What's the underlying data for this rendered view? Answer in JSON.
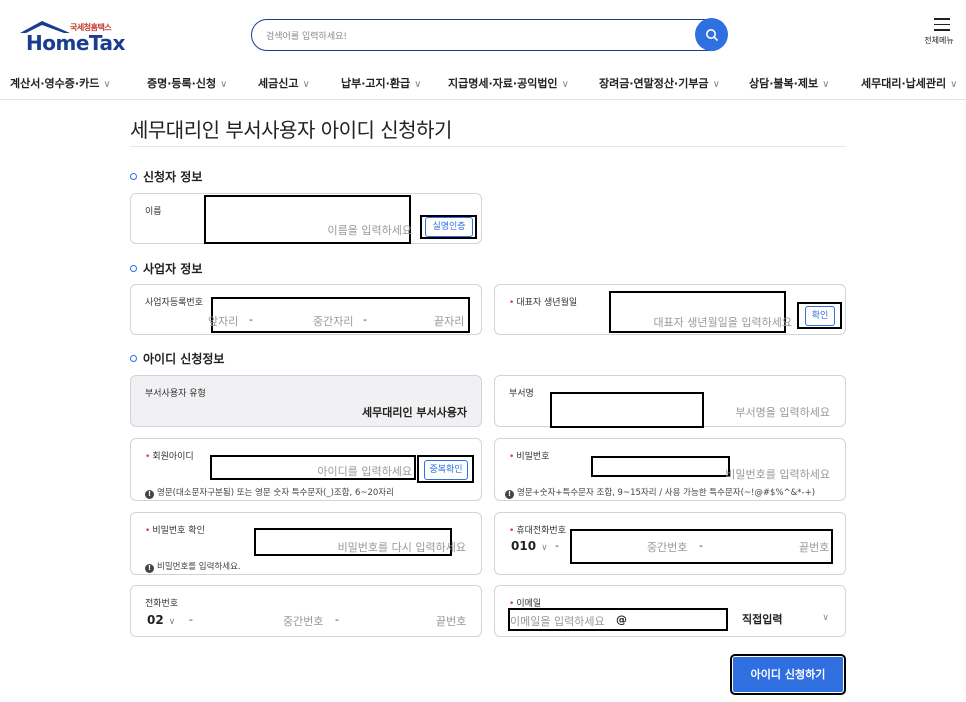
{
  "logo": {
    "sub": "국세청홈택스",
    "main": "HomeTax"
  },
  "search": {
    "placeholder": "검색어를 입력하세요!"
  },
  "menu": {
    "label": "전체메뉴"
  },
  "nav": [
    "계산서·영수증·카드",
    "증명·등록·신청",
    "세금신고",
    "납부·고지·환급",
    "지급명세·자료·공익법인",
    "장려금·연말정산·기부금",
    "상담·불복·제보",
    "세무대리·납세관리"
  ],
  "page_title": "세무대리인 부서사용자 아이디 신청하기",
  "sections": {
    "applicant": "신청자 정보",
    "business": "사업자 정보",
    "id_info": "아이디 신청정보"
  },
  "applicant": {
    "name_label": "이름",
    "name_placeholder": "이름을 입력하세요",
    "verify_button": "실명인증"
  },
  "business": {
    "bizno_label": "사업자등록번호",
    "bizno_front": "앞자리",
    "bizno_dash1": "-",
    "bizno_mid": "중간자리",
    "bizno_dash2": "-",
    "bizno_end": "끝자리",
    "rep_birth_label": "대표자 생년월일",
    "rep_birth_placeholder": "대표자 생년월일을 입력하세요",
    "confirm_button": "확인"
  },
  "id_info": {
    "user_type_label": "부서사용자 유형",
    "user_type_value": "세무대리인 부서사용자",
    "dept_label": "부서명",
    "dept_placeholder": "부서명을 입력하세요",
    "member_id_label": "회원아이디",
    "member_id_placeholder": "아이디를 입력하세요",
    "dup_check_button": "중복확인",
    "member_id_hint": "영문(대소문자구분됨) 또는 영문 숫자 특수문자(_)조합, 6~20자리",
    "password_label": "비밀번호",
    "password_placeholder": "비밀번호를 입력하세요",
    "password_hint": "영문+숫자+특수문자 조합, 9~15자리 / 사용 가능한 특수문자(~!@#$%^&*-+)",
    "password_confirm_label": "비밀번호 확인",
    "password_confirm_placeholder": "비밀번호를 다시 입력하세요",
    "password_confirm_hint": "비밀번호를 입력하세요.",
    "mobile_label": "휴대전화번호",
    "mobile_prefix": "010",
    "mobile_dash": "-",
    "mobile_mid": "중간번호",
    "mobile_dash2": "-",
    "mobile_end": "끝번호",
    "phone_label": "전화번호",
    "phone_prefix": "02",
    "phone_dash": "-",
    "phone_mid": "중간번호",
    "phone_dash2": "-",
    "phone_end": "끝번호",
    "email_label": "이메일",
    "email_placeholder": "이메일을 입력하세요",
    "email_at": "@",
    "email_domain": "직접입력"
  },
  "submit_label": "아이디 신청하기",
  "colors": {
    "brand": "#1a3d8f",
    "accent": "#2f6fe0",
    "required": "#e0384f"
  }
}
